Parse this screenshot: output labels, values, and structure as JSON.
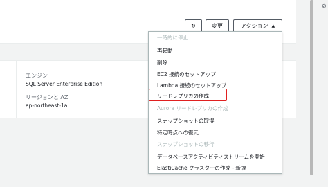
{
  "toolbar": {
    "refresh_glyph": "↻",
    "edit_label": "変更",
    "actions_label": "アクション",
    "actions_caret": "▲"
  },
  "details": {
    "engine_label": "エンジン",
    "engine_value": "SQL Server Enterprise Edition",
    "region_label": "リージョンと AZ",
    "region_value": "ap-northeast-1a"
  },
  "actions_menu": {
    "items": [
      {
        "label": "一時的に停止",
        "disabled": true
      },
      {
        "label": "再起動",
        "disabled": false
      },
      {
        "label": "削除",
        "disabled": false
      },
      {
        "label": "EC2 接続のセットアップ",
        "disabled": false
      },
      {
        "label": "Lambda 接続のセットアップ",
        "disabled": false
      },
      {
        "label": "リードレプリカの作成",
        "disabled": false
      },
      {
        "label": "Aurora リードレプリカの作成",
        "disabled": true
      },
      {
        "label": "スナップショットの取得",
        "disabled": false
      },
      {
        "label": "特定時点への復元",
        "disabled": false
      },
      {
        "label": "スナップショットの移行",
        "disabled": true
      },
      {
        "label": "データベースアクティビティストリームを開始",
        "disabled": false
      },
      {
        "label": "ElastiCache クラスターの作成 - 新規",
        "disabled": false
      }
    ]
  },
  "colors": {
    "highlight": "#e02020"
  },
  "icons": {
    "corner": "settings-icon"
  }
}
